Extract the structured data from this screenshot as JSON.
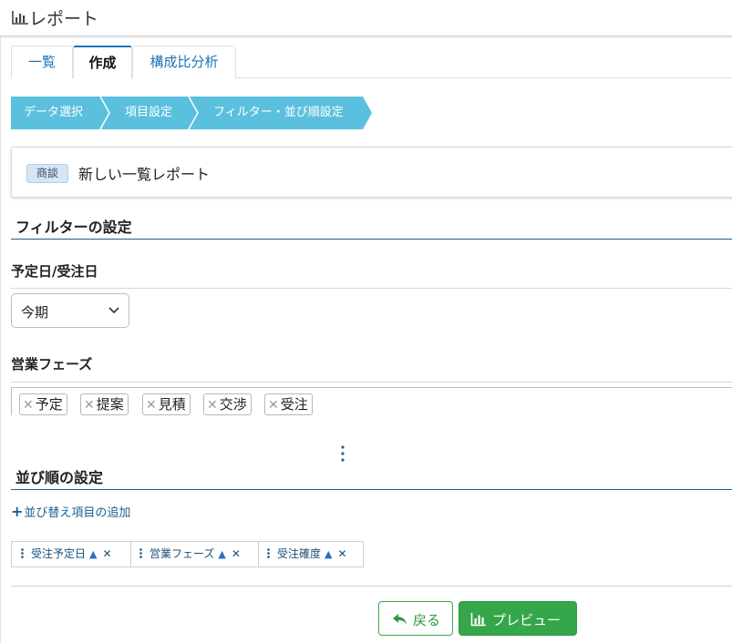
{
  "header": {
    "title": "レポート",
    "icon": "bar-chart-icon"
  },
  "tabs": [
    {
      "label": "一覧",
      "active": false
    },
    {
      "label": "作成",
      "active": true
    },
    {
      "label": "構成比分析",
      "active": false
    }
  ],
  "steps": [
    {
      "label": "データ選択"
    },
    {
      "label": "項目設定"
    },
    {
      "label": "フィルター・並び順設定"
    }
  ],
  "report": {
    "badge": "商談",
    "name": "新しい一覧レポート"
  },
  "filter_section": {
    "title": "フィルターの設定",
    "date_label": "予定日/受注日",
    "date_value": "今期",
    "phase_label": "営業フェーズ",
    "phases": [
      "予定",
      "提案",
      "見積",
      "交渉",
      "受注"
    ]
  },
  "sort_section": {
    "title": "並び順の設定",
    "add_label": "並び替え項目の追加",
    "items": [
      {
        "label": "受注予定日",
        "direction": "asc"
      },
      {
        "label": "営業フェーズ",
        "direction": "asc"
      },
      {
        "label": "受注確度",
        "direction": "asc"
      }
    ]
  },
  "actions": {
    "back_label": "戻る",
    "preview_label": "プレビュー"
  },
  "colors": {
    "accent": "#1a73b8",
    "steps": "#5bc0de",
    "primary_green": "#35a64a"
  }
}
